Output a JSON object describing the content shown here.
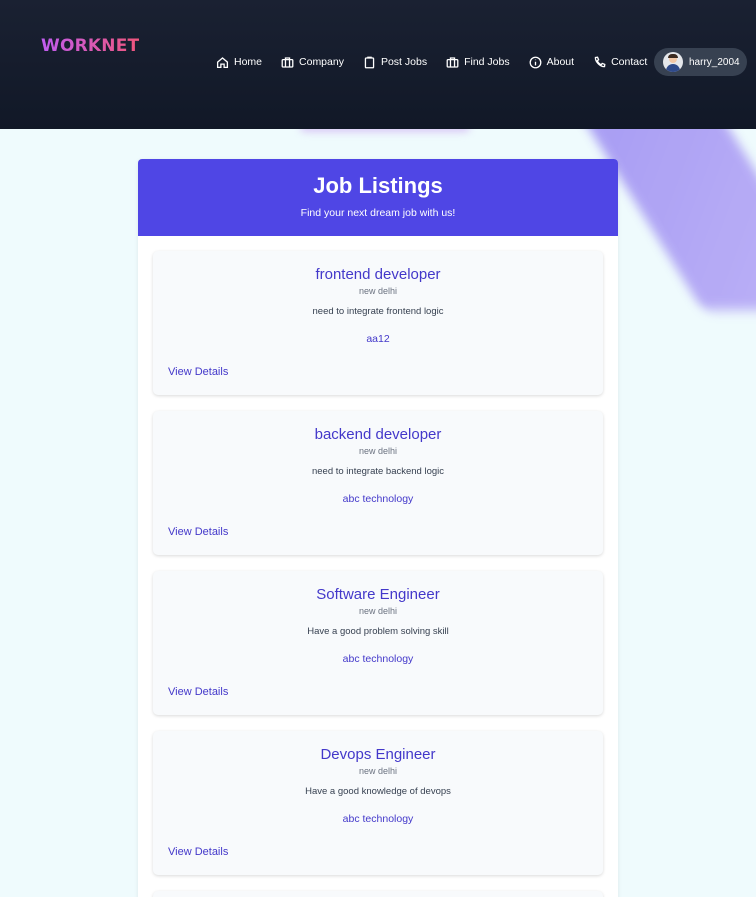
{
  "header": {
    "logo": "WORKNET",
    "nav": [
      {
        "label": "Home",
        "icon": "home-icon"
      },
      {
        "label": "Company",
        "icon": "briefcase-icon"
      },
      {
        "label": "Post Jobs",
        "icon": "clipboard-icon"
      },
      {
        "label": "Find Jobs",
        "icon": "briefcase-icon"
      },
      {
        "label": "About",
        "icon": "info-icon"
      },
      {
        "label": "Contact",
        "icon": "phone-icon"
      }
    ],
    "user": {
      "name": "harry_2004"
    }
  },
  "listing": {
    "title": "Job Listings",
    "subtitle": "Find your next dream job with us!",
    "jobs": [
      {
        "title": "frontend developer",
        "location": "new delhi",
        "description": "need to integrate frontend logic",
        "company": "aa12",
        "link": "View Details"
      },
      {
        "title": "backend developer",
        "location": "new delhi",
        "description": "need to integrate backend logic",
        "company": "abc technology",
        "link": "View Details"
      },
      {
        "title": "Software Engineer",
        "location": "new delhi",
        "description": "Have a good problem solving skill",
        "company": "abc technology",
        "link": "View Details"
      },
      {
        "title": "Devops Engineer",
        "location": "new delhi",
        "description": "Have a good knowledge of devops",
        "company": "abc technology",
        "link": "View Details"
      }
    ]
  },
  "colors": {
    "header_bg": "#111827",
    "accent": "#4f46e5",
    "link": "#4338ca",
    "page_bg": "#effbfd"
  }
}
